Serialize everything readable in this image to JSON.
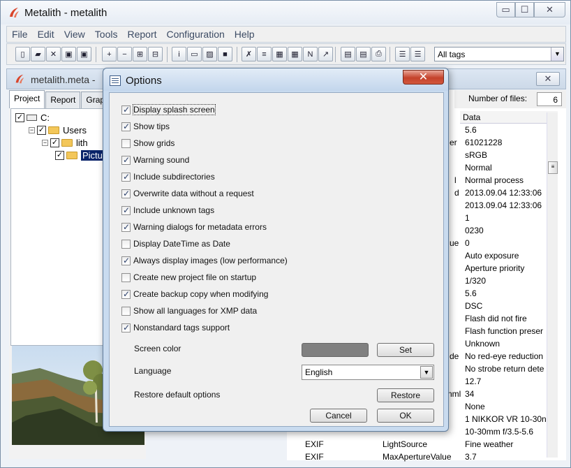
{
  "window": {
    "title": "Metalith - metalith"
  },
  "window_controls": {
    "minimize": "▭",
    "maximize": "☐",
    "close": "✕"
  },
  "menu": [
    "File",
    "Edit",
    "View",
    "Tools",
    "Report",
    "Configuration",
    "Help"
  ],
  "toolbar": {
    "buttons": [
      {
        "name": "new-file-icon",
        "glyph": "▯"
      },
      {
        "name": "open-folder-icon",
        "glyph": "▰"
      },
      {
        "name": "delete-icon",
        "glyph": "✕"
      },
      {
        "name": "save-icon",
        "glyph": "▣"
      },
      {
        "name": "save-as-icon",
        "glyph": "▣"
      },
      {
        "name": "add-icon",
        "glyph": "+"
      },
      {
        "name": "remove-icon",
        "glyph": "−"
      },
      {
        "name": "expand-icon",
        "glyph": "⊞"
      },
      {
        "name": "collapse-icon",
        "glyph": "⊟"
      },
      {
        "name": "info-icon",
        "glyph": "i"
      },
      {
        "name": "window-icon",
        "glyph": "▭"
      },
      {
        "name": "image-icon",
        "glyph": "▨"
      },
      {
        "name": "gray-square-icon",
        "glyph": "■"
      },
      {
        "name": "clear-icon",
        "glyph": "✗"
      },
      {
        "name": "list-delete-icon",
        "glyph": "≡"
      },
      {
        "name": "calendar-icon",
        "glyph": "▦"
      },
      {
        "name": "calendar-edit-icon",
        "glyph": "▦"
      },
      {
        "name": "n-icon",
        "glyph": "N"
      },
      {
        "name": "export-icon",
        "glyph": "↗"
      },
      {
        "name": "preview-icon",
        "glyph": "▤"
      },
      {
        "name": "report-icon",
        "glyph": "▤"
      },
      {
        "name": "print-icon",
        "glyph": "⎙"
      },
      {
        "name": "grid-view-icon",
        "glyph": "☰"
      },
      {
        "name": "list-view-icon",
        "glyph": "☰"
      }
    ],
    "tags_filter": "All tags"
  },
  "document": {
    "title": "metalith.meta -"
  },
  "left_tabs": [
    "Project",
    "Report",
    "Grap"
  ],
  "tree": [
    {
      "label": "C:",
      "level": 0,
      "checked": true,
      "kind": "drive"
    },
    {
      "label": "Users",
      "level": 1,
      "checked": true,
      "kind": "folder"
    },
    {
      "label": "lith",
      "level": 2,
      "checked": true,
      "kind": "folder"
    },
    {
      "label": "Pictur",
      "level": 3,
      "checked": true,
      "kind": "folder",
      "selected": true
    }
  ],
  "files": {
    "label": "Number of files:",
    "count": "6"
  },
  "grid": {
    "header": "Data",
    "values": [
      {
        "frag": "",
        "data": "5.6"
      },
      {
        "frag": "er",
        "data": "61021228"
      },
      {
        "frag": "",
        "data": "sRGB"
      },
      {
        "frag": "",
        "data": "Normal"
      },
      {
        "frag": "l",
        "data": "Normal process"
      },
      {
        "frag": "d",
        "data": "2013.09.04 12:33:06"
      },
      {
        "frag": "",
        "data": "2013.09.04 12:33:06"
      },
      {
        "frag": "",
        "data": "1"
      },
      {
        "frag": "",
        "data": "0230"
      },
      {
        "frag": "ue",
        "data": "0"
      },
      {
        "frag": "",
        "data": "Auto exposure"
      },
      {
        "frag": "",
        "data": "Aperture priority"
      },
      {
        "frag": "",
        "data": "1/320"
      },
      {
        "frag": "",
        "data": "5.6"
      },
      {
        "frag": "",
        "data": "DSC"
      },
      {
        "frag": "",
        "data": "Flash did not fire"
      },
      {
        "frag": "",
        "data": "Flash function preser"
      },
      {
        "frag": "",
        "data": "Unknown"
      },
      {
        "frag": "de",
        "data": "No red-eye reduction"
      },
      {
        "frag": "",
        "data": "No strobe return dete"
      },
      {
        "frag": "",
        "data": "12.7"
      },
      {
        "frag": "nml",
        "data": "34"
      },
      {
        "frag": "",
        "data": "None"
      },
      {
        "frag": "",
        "data": "1 NIKKOR VR 10-30n"
      },
      {
        "frag": "",
        "data": "10-30mm f/3.5-5.6"
      }
    ],
    "bottom_rows": [
      {
        "group": "EXIF",
        "tag": "LightSource",
        "data": "Fine weather"
      },
      {
        "group": "EXIF",
        "tag": "MaxApertureValue",
        "data": "3.7"
      }
    ]
  },
  "dialog": {
    "title": "Options",
    "close_glyph": "✕",
    "options": [
      {
        "label": "Display splash screen",
        "checked": true
      },
      {
        "label": "Show tips",
        "checked": true
      },
      {
        "label": "Show grids",
        "checked": false
      },
      {
        "label": "Warning sound",
        "checked": true
      },
      {
        "label": "Include subdirectories",
        "checked": true
      },
      {
        "label": "Overwrite data without a request",
        "checked": true
      },
      {
        "label": "Include unknown tags",
        "checked": true
      },
      {
        "label": "Warning dialogs for metadata errors",
        "checked": true
      },
      {
        "label": "Display DateTime as Date",
        "checked": false
      },
      {
        "label": "Always display images (low performance)",
        "checked": true
      },
      {
        "label": "Create new project file on startup",
        "checked": false
      },
      {
        "label": "Create backup copy when modifying",
        "checked": true
      },
      {
        "label": "Show all languages for XMP data",
        "checked": false
      },
      {
        "label": "Nonstandard tags support",
        "checked": true
      }
    ],
    "screen_color_label": "Screen color",
    "screen_color": "#808080",
    "set_label": "Set",
    "language_label": "Language",
    "language_value": "English",
    "restore_label_text": "Restore default options",
    "restore_button": "Restore",
    "cancel_button": "Cancel",
    "ok_button": "OK"
  }
}
